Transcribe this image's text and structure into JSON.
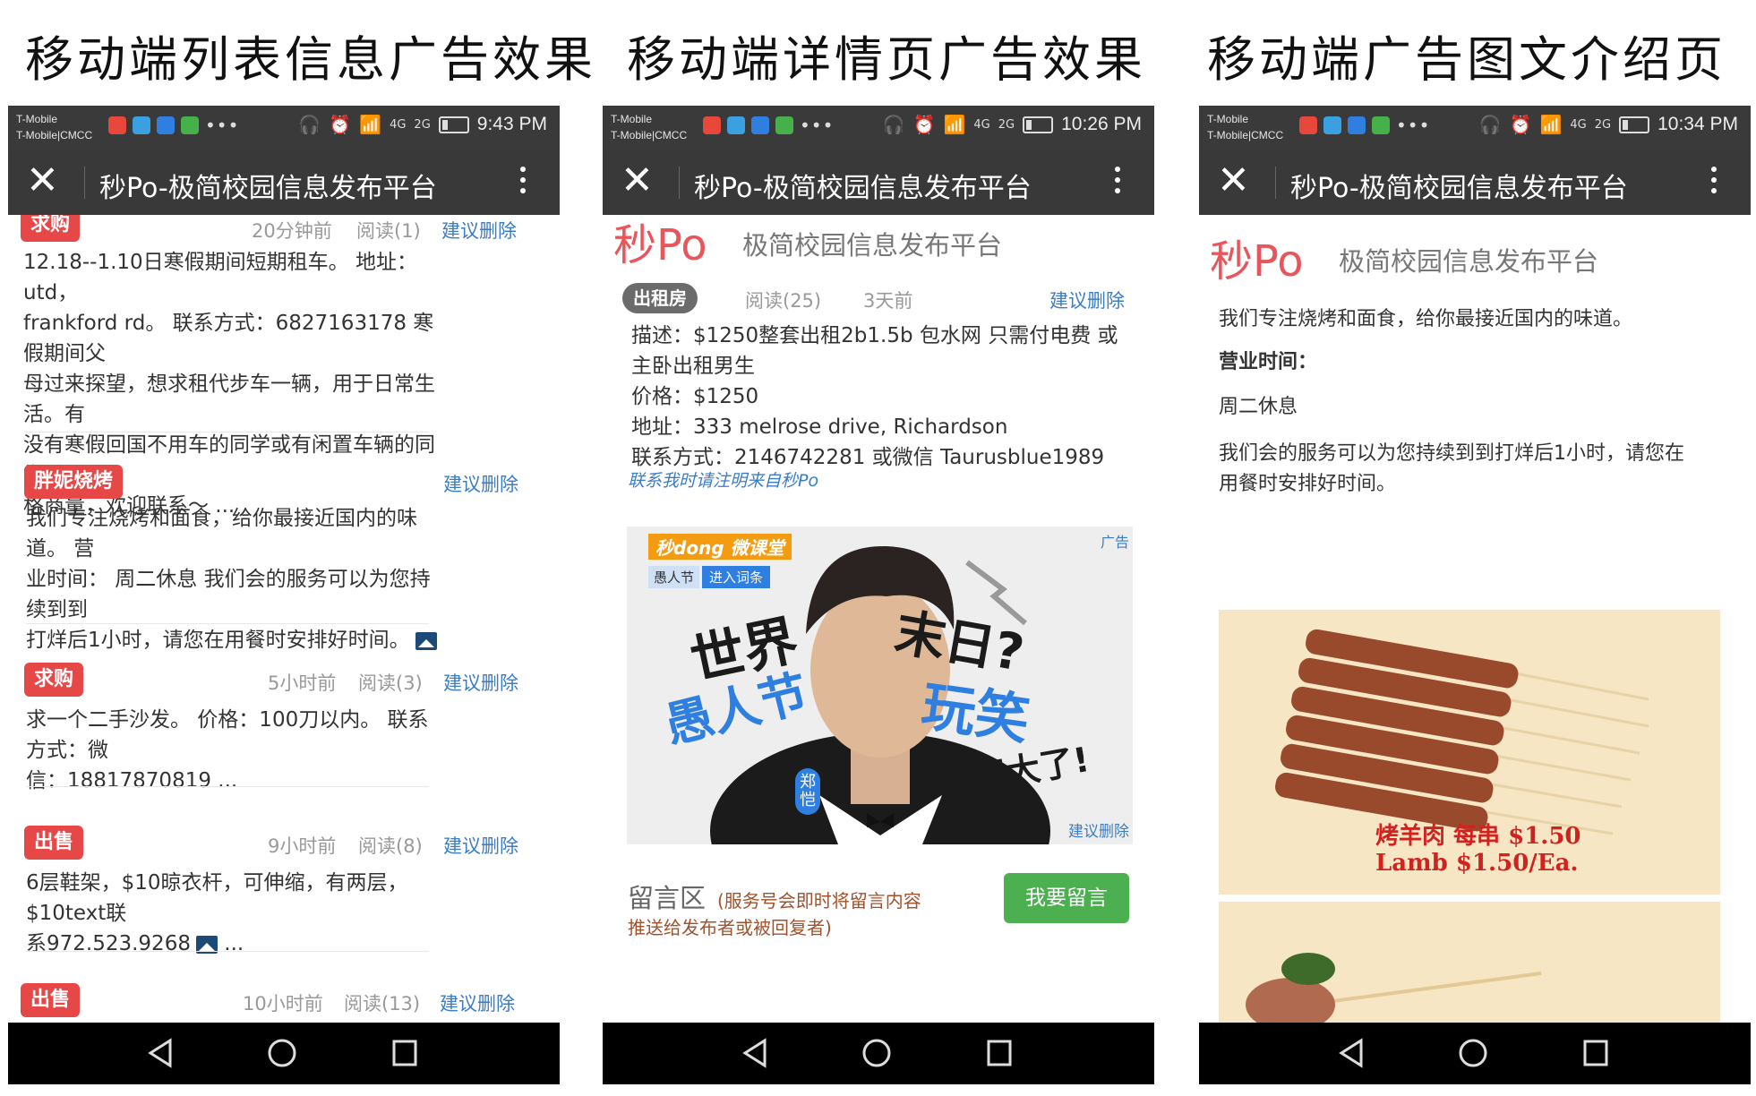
{
  "captions": [
    "移动端列表信息广告效果",
    "移动端详情页广告效果",
    "移动端广告图文介绍页"
  ],
  "statusbar": {
    "carrier_line1": "T-Mobile",
    "carrier_line2": "T-Mobile|CMCC",
    "net_4g": "4G",
    "net_2g": "2G",
    "times": [
      "9:43 PM",
      "10:26 PM",
      "10:34 PM"
    ]
  },
  "titlebar": {
    "title": "秒Po-极简校园信息发布平台",
    "close_icon": "close-icon",
    "menu_icon": "kebab-menu-icon"
  },
  "colors": {
    "tag_red": "#e64848",
    "link_blue": "#3b7dc4",
    "logo_red": "#e8555a",
    "button_green": "#4caf50",
    "bar_dark": "#393939"
  },
  "list_screen": {
    "posts": [
      {
        "tag": "求购",
        "time": "20分钟前",
        "reads": "阅读(1)",
        "action": "建议删除",
        "lines": [
          "12.18--1.10日寒假期间短期租车。 地址：utd，",
          "frankford rd。 联系方式：6827163178 寒假期间父",
          "母过来探望，想求租代步车一辆，用于日常生活。有",
          "没有寒假回国不用车的同学或有闲置车辆的同学，价",
          "格商量，欢迎联系～ ..."
        ]
      },
      {
        "tag": "胖妮烧烤",
        "action": "建议删除",
        "lines": [
          "我们专注烧烤和面食，给你最接近国内的味道。 营",
          "业时间： 周二休息 我们会的服务可以为您持续到到",
          "打烊后1小时，请您在用餐时安排好时间。"
        ]
      },
      {
        "tag": "求购",
        "time": "5小时前",
        "reads": "阅读(3)",
        "action": "建议删除",
        "lines": [
          "求一个二手沙发。 价格：100刀以内。 联系方式：微",
          "信：18817870819 ..."
        ]
      },
      {
        "tag": "出售",
        "time": "9小时前",
        "reads": "阅读(8)",
        "action": "建议删除",
        "lines": [
          "6层鞋架，$10晾衣杆，可伸缩，有两层，$10text联",
          "系972.523.9268",
          "..."
        ]
      },
      {
        "tag": "出售",
        "time": "10小时前",
        "reads": "阅读(13)",
        "action": "建议删除"
      }
    ]
  },
  "detail_screen": {
    "logo": "秒Po",
    "logo_sub": "极简校园信息发布平台",
    "tag": "出租房",
    "reads": "阅读(25)",
    "time": "3天前",
    "action": "建议删除",
    "desc_lines": [
      "描述：$1250整套出租2b1.5b 包水网 只需付电费 或",
      "主卧出租男生"
    ],
    "price": "价格：$1250",
    "address": "地址：333 melrose drive, Richardson",
    "contact": "联系方式：2146742281 或微信 Taurusblue1989",
    "note": "联系我时请注明来自秒Po",
    "ad": {
      "badge": "广告",
      "delete": "建议删除",
      "brand": "秒dong 微课堂",
      "chip1": "愚人节",
      "chip2": "进入词条",
      "text_world": "世界",
      "text_end": "末日?",
      "text_fool": "愚人节",
      "text_joke": "玩笑",
      "text_big": "开大了!",
      "name_badge": "郑恺"
    },
    "comment_title": "留言区",
    "comment_hint": "(服务号会即时将留言内容",
    "comment_hint2": "推送给发布者或被回复者)",
    "comment_button": "我要留言"
  },
  "intro_screen": {
    "logo": "秒Po",
    "logo_sub": "极简校园信息发布平台",
    "p1": "我们专注烧烤和面食，给你最接近国内的味道。",
    "hours_label": "营业时间：",
    "hours": "周二休息",
    "p2_lines": [
      "我们会的服务可以为您持续到到打烊后1小时，请您在",
      "用餐时安排好时间。"
    ],
    "img_caption1": "烤羊肉 每串 $1.50",
    "img_caption2": "Lamb $1.50/Ea."
  }
}
